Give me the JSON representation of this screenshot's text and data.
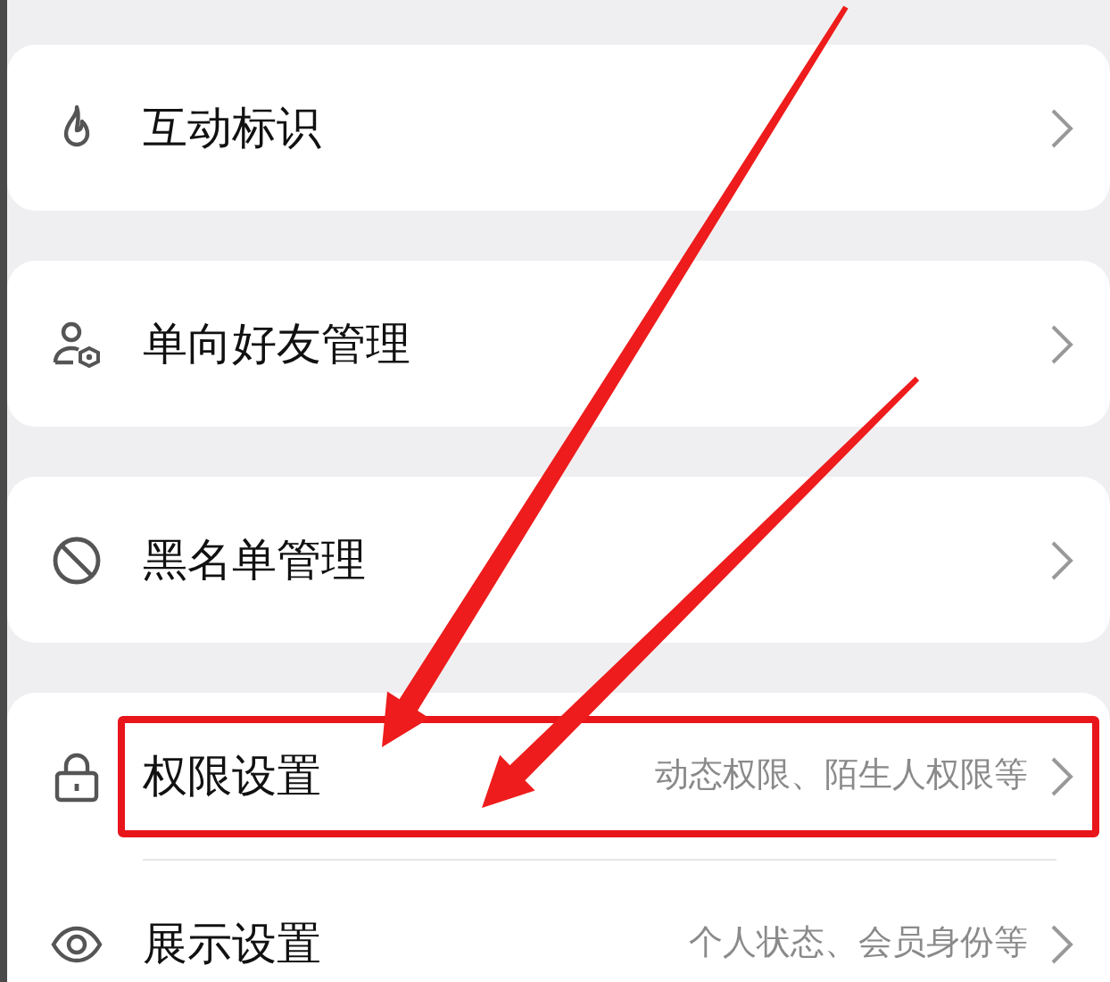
{
  "groups": [
    {
      "items": [
        {
          "label": "互动标识",
          "highlighted": false
        }
      ]
    },
    {
      "items": [
        {
          "label": "单向好友管理",
          "highlighted": false
        }
      ]
    },
    {
      "items": [
        {
          "label": "黑名单管理",
          "highlighted": false
        }
      ]
    },
    {
      "items": [
        {
          "label": "权限设置",
          "hint": "动态权限、陌生人权限等",
          "highlighted": true
        },
        {
          "label": "展示设置",
          "hint": "个人状态、会员身份等",
          "highlighted": false
        }
      ]
    }
  ]
}
